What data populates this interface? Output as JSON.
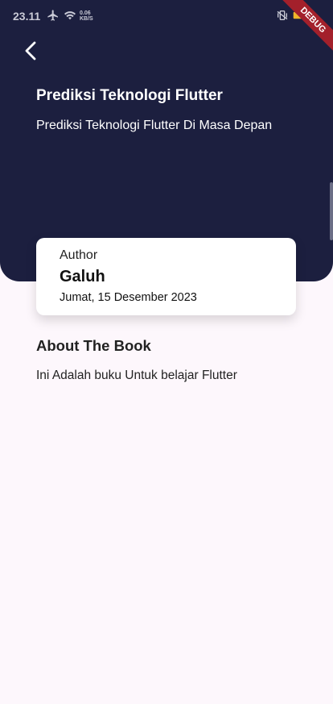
{
  "status_bar": {
    "time": "23.11",
    "net_speed_value": "0.06",
    "net_speed_unit": "KB/S",
    "icons": [
      "airplane-icon",
      "wifi-icon",
      "vibrate-icon",
      "battery-icon"
    ]
  },
  "debug_banner": "DEBUG",
  "book": {
    "title": "Prediksi Teknologi Flutter",
    "subtitle": "Prediksi Teknologi Flutter Di Masa Depan"
  },
  "author": {
    "label": "Author",
    "name": "Galuh",
    "date": "Jumat, 15 Desember 2023"
  },
  "about": {
    "heading": "About The Book",
    "body": "Ini Adalah buku Untuk belajar Flutter"
  },
  "colors": {
    "header_bg": "#1c1f3f",
    "page_bg": "#fdf7fc",
    "debug_red": "#a3202b"
  }
}
